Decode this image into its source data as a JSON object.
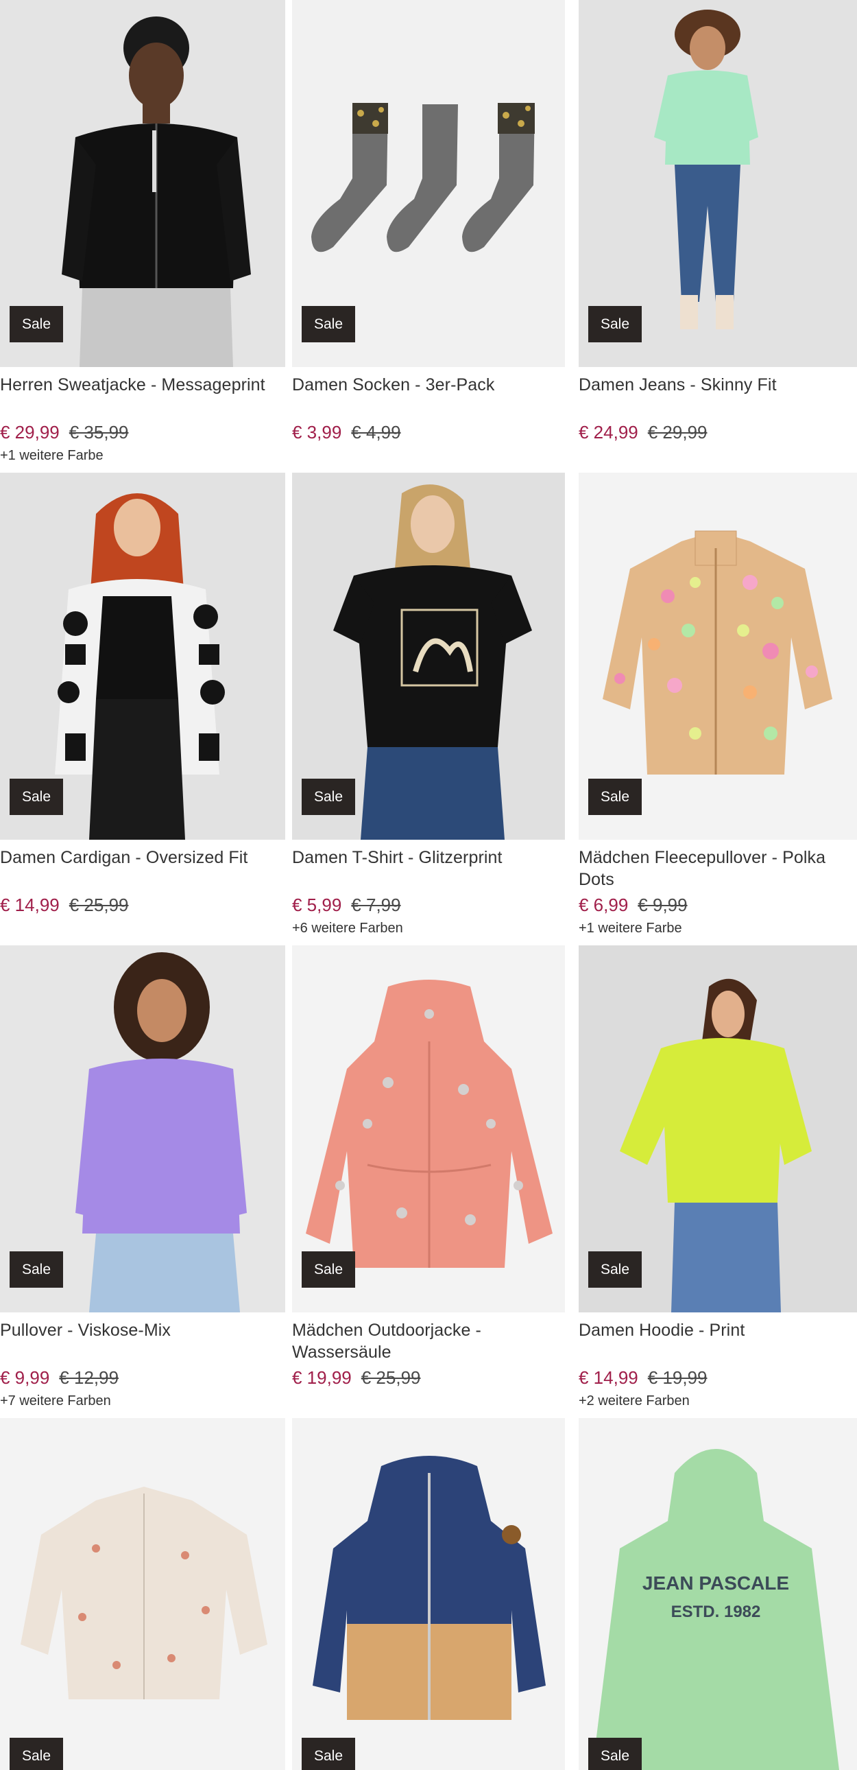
{
  "badge_label": "Sale",
  "products": [
    {
      "name": "Herren Sweatjacke - Messageprint",
      "price": "€ 29,99",
      "old_price": "€ 35,99",
      "colors": "+1 weitere Farbe",
      "image": "black-zip-jacket-man"
    },
    {
      "name": "Damen Socken - 3er-Pack",
      "price": "€ 3,99",
      "old_price": "€ 4,99",
      "colors": "",
      "image": "grey-socks-leopard"
    },
    {
      "name": "Damen Jeans - Skinny Fit",
      "price": "€ 24,99",
      "old_price": "€ 29,99",
      "colors": "",
      "image": "woman-mint-sweater-jeans"
    },
    {
      "name": "Damen Cardigan - Oversized Fit",
      "price": "€ 14,99",
      "old_price": "€ 25,99",
      "colors": "",
      "image": "woman-flower-cardigan"
    },
    {
      "name": "Damen T-Shirt - Glitzerprint",
      "price": "€ 5,99",
      "old_price": "€ 7,99",
      "colors": "+6 weitere Farben",
      "image": "woman-black-tshirt"
    },
    {
      "name": "Mädchen Fleecepullover - Polka Dots",
      "price": "€ 6,99",
      "old_price": "€ 9,99",
      "colors": "+1 weitere Farbe",
      "image": "polka-dot-fleece"
    },
    {
      "name": "Pullover - Viskose-Mix",
      "price": "€ 9,99",
      "old_price": "€ 12,99",
      "colors": "+7 weitere Farben",
      "image": "woman-purple-pullover"
    },
    {
      "name": "Mädchen Outdoorjacke - Wassersäule",
      "price": "€ 19,99",
      "old_price": "€ 25,99",
      "colors": "",
      "image": "pink-rain-jacket"
    },
    {
      "name": "Damen Hoodie - Print",
      "price": "€ 14,99",
      "old_price": "€ 19,99",
      "colors": "+2 weitere Farben",
      "image": "woman-yellow-hoodie"
    },
    {
      "name": "",
      "price": "",
      "old_price": "",
      "colors": "",
      "image": "quilted-jacket"
    },
    {
      "name": "",
      "price": "",
      "old_price": "",
      "colors": "",
      "image": "navy-beige-jacket"
    },
    {
      "name": "",
      "price": "",
      "old_price": "",
      "colors": "",
      "image": "mint-hoodie-print"
    }
  ],
  "print_text": {
    "line1": "JEAN PASCALE",
    "line2": "ESTD. 1982"
  }
}
